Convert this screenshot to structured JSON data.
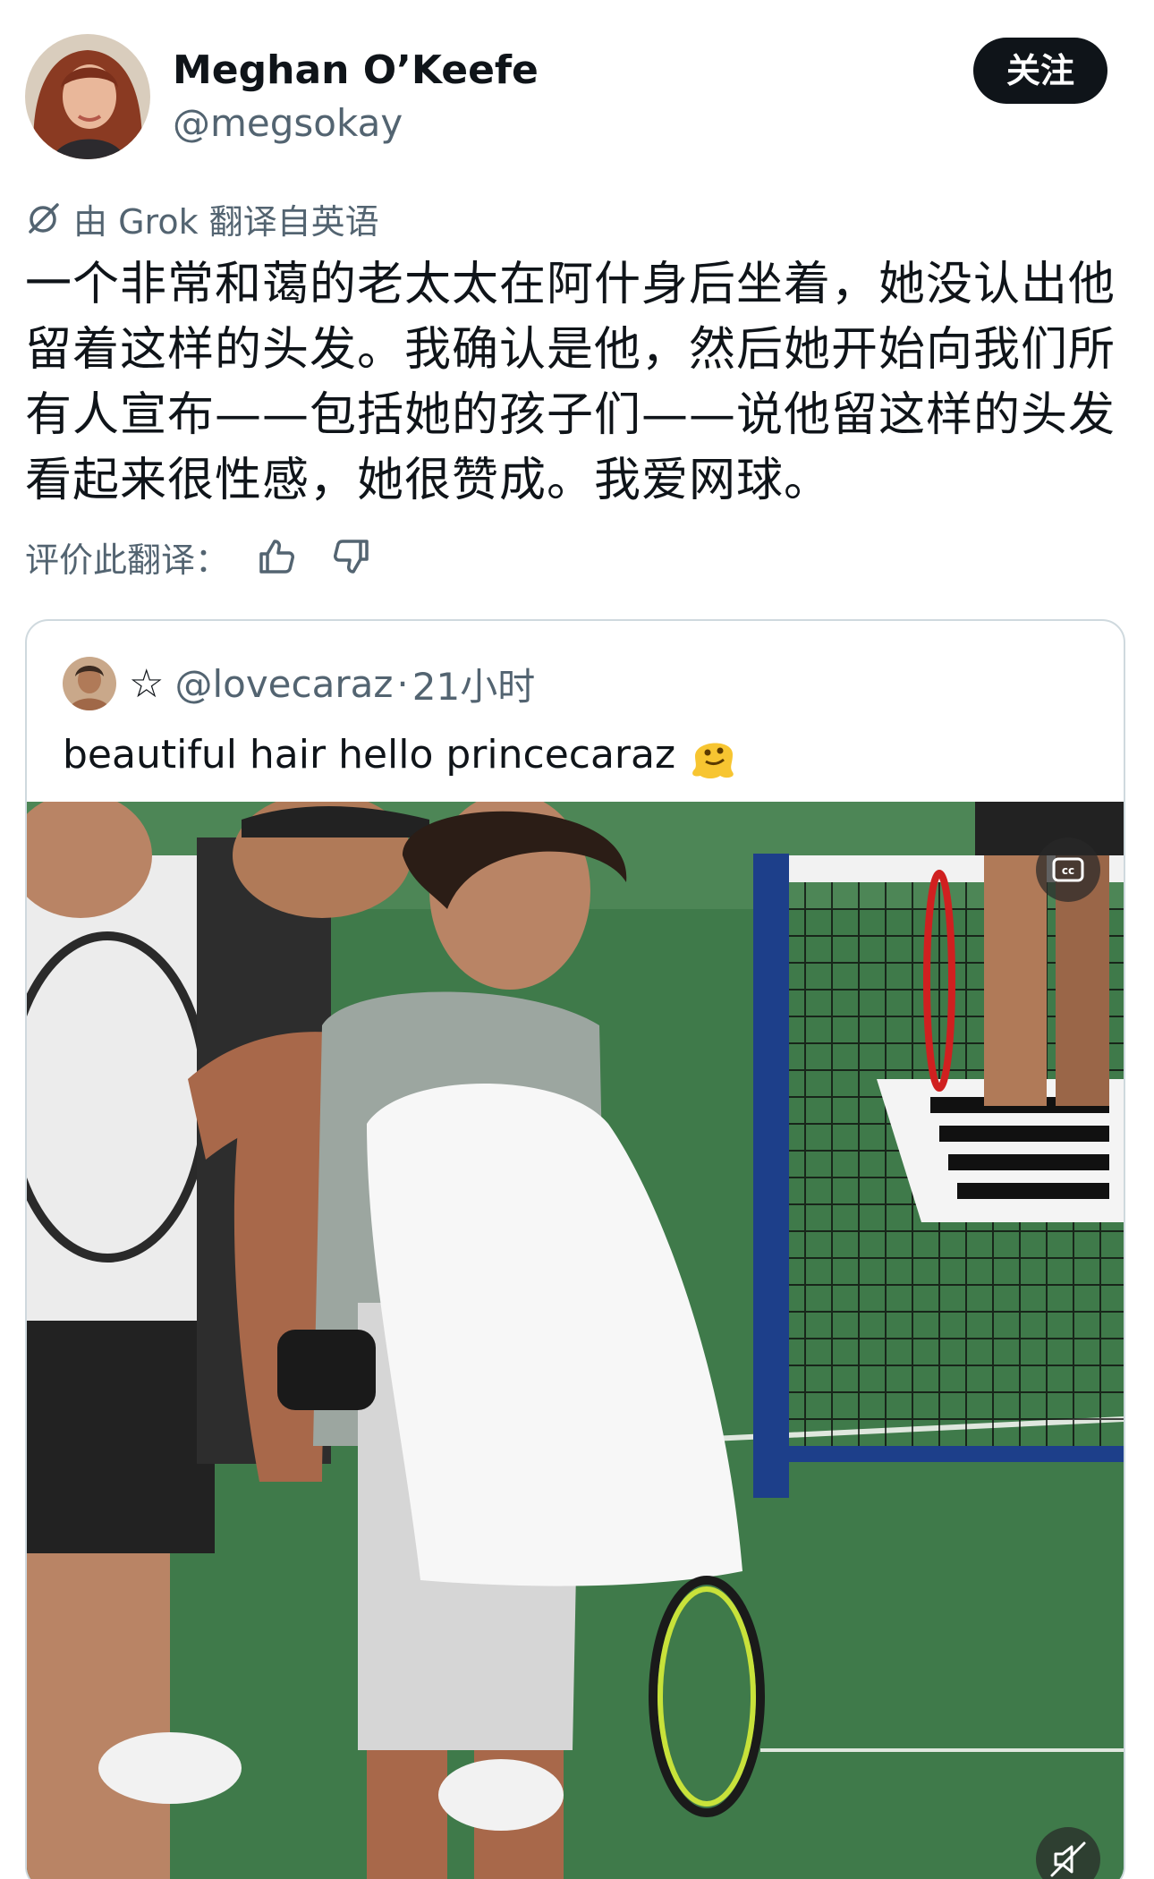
{
  "author": {
    "display_name": "Meghan O’Keefe",
    "handle": "@megsokay",
    "follow_label": "关注"
  },
  "translation": {
    "notice": "由 Grok 翻译自英语",
    "text": "一个非常和蔼的老太太在阿什身后坐着，她没认出他留着这样的头发。我确认是他，然后她开始向我们所有人宣布——包括她的孩子们——说他留这样的头发看起来很性感，她很赞成。我爱网球。",
    "rate_label": "评价此翻译："
  },
  "quote": {
    "handle": "@lovecaraz",
    "separator": "·",
    "time": "21小时",
    "star": "☆",
    "text": "beautiful hair hello princecaraz"
  },
  "icons": {
    "translate": "grok-translate-icon",
    "thumbs_up": "thumbs-up-icon",
    "thumbs_down": "thumbs-down-icon",
    "emoji": "melting-face-emoji-icon",
    "cc": "closed-captions-icon",
    "mute": "speaker-muted-icon"
  },
  "colors": {
    "text_primary": "#0f1419",
    "text_secondary": "#536471",
    "follow_bg": "#0f1419",
    "card_border": "#cfd9de",
    "court_green": "#3f7a4a"
  }
}
